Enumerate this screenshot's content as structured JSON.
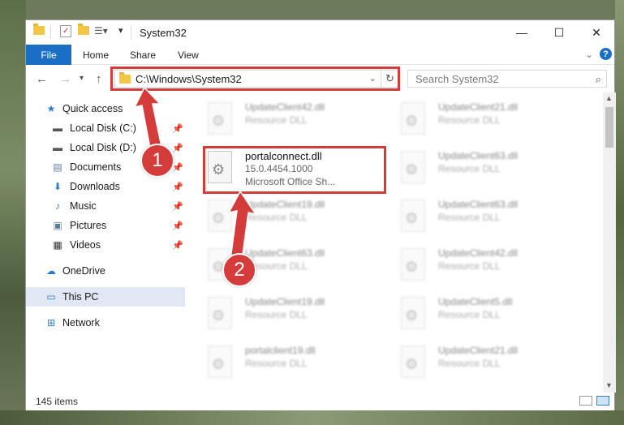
{
  "window": {
    "title": "System32",
    "minimize": "—",
    "maximize": "☐",
    "close": "✕"
  },
  "ribbon": {
    "tabs": [
      "File",
      "Home",
      "Share",
      "View"
    ],
    "help": "?",
    "collapse": "⌄"
  },
  "address": {
    "path": "C:\\Windows\\System32",
    "search_placeholder": "Search System32"
  },
  "nav_pane": {
    "items": [
      {
        "label": "Quick access",
        "icon": "star-icon"
      },
      {
        "label": "Local Disk (C:)",
        "icon": "drive-icon",
        "pinned": true
      },
      {
        "label": "Local Disk (D:)",
        "icon": "drive-icon",
        "pinned": true
      },
      {
        "label": "Documents",
        "icon": "document-icon",
        "pinned": true
      },
      {
        "label": "Downloads",
        "icon": "download-icon",
        "pinned": true
      },
      {
        "label": "Music",
        "icon": "music-icon",
        "pinned": true
      },
      {
        "label": "Pictures",
        "icon": "pictures-icon",
        "pinned": true
      },
      {
        "label": "Videos",
        "icon": "videos-icon",
        "pinned": true
      },
      {
        "label": "OneDrive",
        "icon": "cloud-icon"
      },
      {
        "label": "This PC",
        "icon": "computer-icon",
        "selected": true
      },
      {
        "label": "Network",
        "icon": "network-icon"
      }
    ]
  },
  "files": {
    "left": [
      {
        "name": "UpdateClient42.dll",
        "type": "Resource DLL"
      },
      {
        "name": "portalconnect.dll",
        "version": "15.0.4454.1000",
        "desc": "Microsoft Office Sh..."
      },
      {
        "name": "UpdateClient19.dll",
        "type": "Resource DLL"
      },
      {
        "name": "UpdateClient63.dll",
        "type": "Resource DLL"
      },
      {
        "name": "UpdateClient19.dll",
        "type": "Resource DLL"
      },
      {
        "name": "portalclient19.dll",
        "type": "Resource DLL"
      }
    ],
    "right": [
      {
        "name": "UpdateClient21.dll",
        "type": "Resource DLL"
      },
      {
        "name": "UpdateClient63.dll",
        "type": "Resource DLL"
      },
      {
        "name": "UpdateClient63.dll",
        "type": "Resource DLL"
      },
      {
        "name": "UpdateClient42.dll",
        "type": "Resource DLL"
      },
      {
        "name": "UpdateClient5.dll",
        "type": "Resource DLL"
      },
      {
        "name": "UpdateClient21.dll",
        "type": "Resource DLL"
      }
    ]
  },
  "status": {
    "item_count": "145 items"
  },
  "callouts": {
    "one": "1",
    "two": "2"
  },
  "colors": {
    "accent": "#1a6fc4",
    "highlight": "#d43c3c",
    "selected_nav": "#dfe8f3"
  }
}
